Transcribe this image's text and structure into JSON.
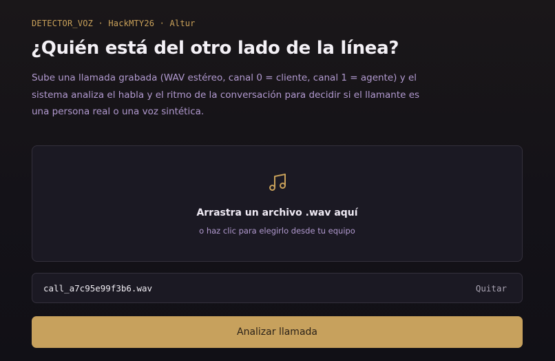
{
  "header": {
    "eyebrow": "DETECTOR_VOZ · HackMTY26 · Altur",
    "title": "¿Quién está del otro lado de la línea?",
    "description": "Sube una llamada grabada (WAV estéreo, canal 0 = cliente, canal 1 = agente) y el sistema analiza el habla y el ritmo de la conversación para decidir si el llamante es una persona real o una voz sintética."
  },
  "dropzone": {
    "icon": "music-note-icon",
    "title": "Arrastra un archivo .wav aquí",
    "subtitle": "o haz clic para elegirlo desde tu equipo"
  },
  "file": {
    "name": "call_a7c95e99f3b6.wav",
    "remove_label": "Quitar"
  },
  "actions": {
    "analyze_label": "Analizar llamada"
  },
  "colors": {
    "accent": "#c7a15d",
    "description_text": "#b29ad0",
    "background": "#141218"
  }
}
